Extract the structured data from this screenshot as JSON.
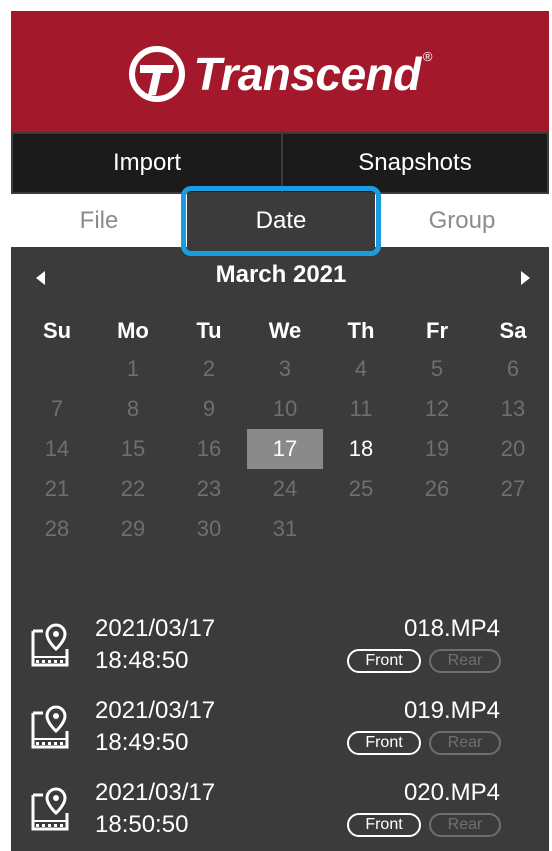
{
  "brand": {
    "name": "Transcend",
    "reg_mark": "®",
    "color": "#a3192b"
  },
  "top_tabs": [
    {
      "label": "Import"
    },
    {
      "label": "Snapshots"
    }
  ],
  "sub_tabs": [
    {
      "label": "File",
      "selected": false
    },
    {
      "label": "Date",
      "selected": true
    },
    {
      "label": "Group",
      "selected": false
    }
  ],
  "highlight_color": "#1b9be0",
  "calendar": {
    "title": "March 2021",
    "weekdays": [
      "Su",
      "Mo",
      "Tu",
      "We",
      "Th",
      "Fr",
      "Sa"
    ],
    "weeks": [
      [
        "",
        "1",
        "2",
        "3",
        "4",
        "5",
        "6"
      ],
      [
        "7",
        "8",
        "9",
        "10",
        "11",
        "12",
        "13"
      ],
      [
        "14",
        "15",
        "16",
        "17",
        "18",
        "19",
        "20"
      ],
      [
        "21",
        "22",
        "23",
        "24",
        "25",
        "26",
        "27"
      ],
      [
        "28",
        "29",
        "30",
        "31",
        "",
        "",
        ""
      ]
    ],
    "selected_day": "17",
    "active_days": [
      "17",
      "18"
    ]
  },
  "recordings": [
    {
      "date": "2021/03/17",
      "time": "18:48:50",
      "file": "018.MP4",
      "front_label": "Front",
      "rear_label": "Rear"
    },
    {
      "date": "2021/03/17",
      "time": "18:49:50",
      "file": "019.MP4",
      "front_label": "Front",
      "rear_label": "Rear"
    },
    {
      "date": "2021/03/17",
      "time": "18:50:50",
      "file": "020.MP4",
      "front_label": "Front",
      "rear_label": "Rear"
    }
  ]
}
